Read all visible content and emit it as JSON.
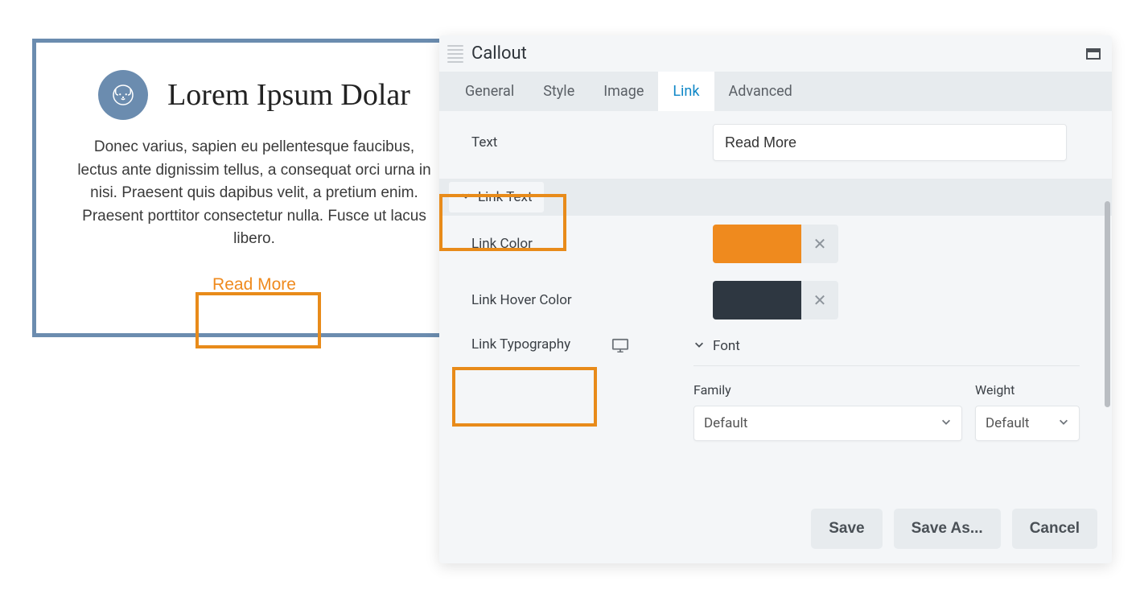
{
  "preview": {
    "title": "Lorem Ipsum Dolar",
    "body": "Donec varius, sapien eu pellentesque faucibus, lectus ante dignissim tellus, a consequat orci urna in nisi. Praesent quis dapibus velit, a pretium enim. Praesent porttitor consectetur nulla. Fusce ut lacus libero.",
    "cta": "Read More"
  },
  "panel": {
    "title": "Callout",
    "tabs": {
      "general": "General",
      "style": "Style",
      "image": "Image",
      "link": "Link",
      "advanced": "Advanced"
    },
    "fields": {
      "text_label": "Text",
      "text_value": "Read More",
      "section_link_text": "Link Text",
      "link_color_label": "Link Color",
      "link_color_value": "#ef8a1e",
      "link_hover_color_label": "Link Hover Color",
      "link_hover_color_value": "#2e3741",
      "link_typography_label": "Link Typography",
      "font_section": "Font",
      "family_label": "Family",
      "family_value": "Default",
      "weight_label": "Weight",
      "weight_value": "Default"
    },
    "footer": {
      "save": "Save",
      "save_as": "Save As...",
      "cancel": "Cancel"
    }
  }
}
